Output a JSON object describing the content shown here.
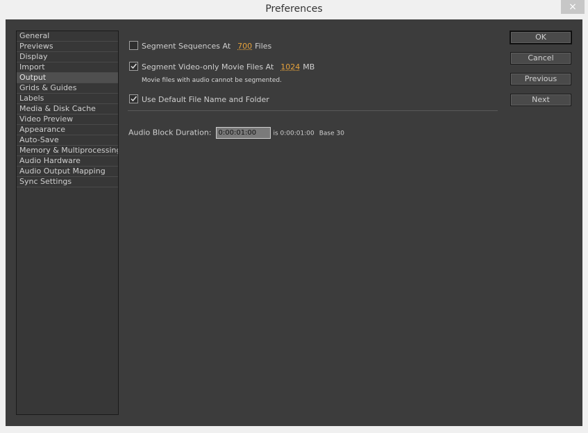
{
  "window": {
    "title": "Preferences",
    "close_label": "×"
  },
  "sidebar": {
    "items": [
      {
        "label": "General"
      },
      {
        "label": "Previews"
      },
      {
        "label": "Display"
      },
      {
        "label": "Import"
      },
      {
        "label": "Output",
        "selected": true
      },
      {
        "label": "Grids & Guides"
      },
      {
        "label": "Labels"
      },
      {
        "label": "Media & Disk Cache"
      },
      {
        "label": "Video Preview"
      },
      {
        "label": "Appearance"
      },
      {
        "label": "Auto-Save"
      },
      {
        "label": "Memory & Multiprocessing"
      },
      {
        "label": "Audio Hardware"
      },
      {
        "label": "Audio Output Mapping"
      },
      {
        "label": "Sync Settings"
      }
    ]
  },
  "output": {
    "segment_sequences": {
      "label": "Segment Sequences At",
      "value": "700",
      "unit": "Files",
      "checked": false
    },
    "segment_video": {
      "label": "Segment Video-only Movie Files At",
      "value": "1024",
      "unit": "MB",
      "checked": true
    },
    "segment_note": "Movie files with audio cannot be segmented.",
    "use_default": {
      "label": "Use Default File Name and Folder",
      "checked": true
    },
    "audio_block": {
      "label": "Audio Block Duration:",
      "value": "0:00:01:00",
      "is_text": "is 0:00:01:00",
      "base_text": "Base 30"
    }
  },
  "buttons": {
    "ok": "OK",
    "cancel": "Cancel",
    "previous": "Previous",
    "next": "Next"
  },
  "colors": {
    "accent_value": "#e6a23b",
    "panel_bg": "#3c3c3c"
  },
  "icons": {
    "check": "checkmark-icon",
    "close": "close-icon"
  }
}
